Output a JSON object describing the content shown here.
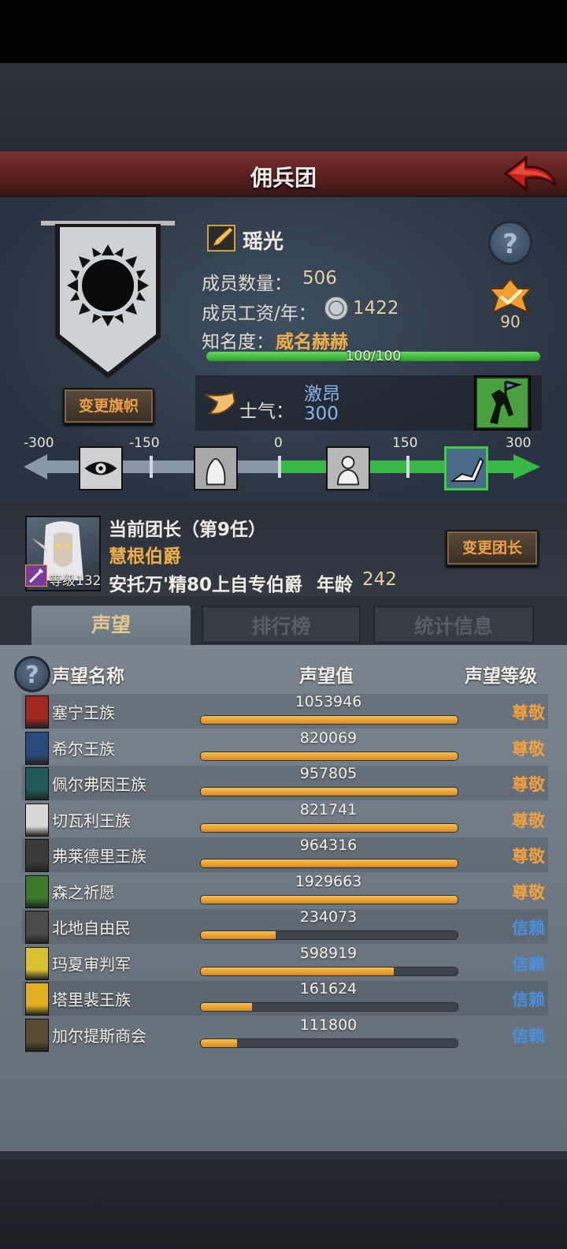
{
  "header": {
    "title": "佣兵团"
  },
  "company": {
    "name": "瑶光",
    "members_label": "成员数量：",
    "members_value": "506",
    "salary_label": "成员工资/年：",
    "salary_value": "1422",
    "fame_label": "知名度：",
    "fame_value": "威名赫赫",
    "fame_progress": "100/100",
    "fame_fraction": 1.0,
    "badge_value": "90",
    "change_banner_label": "变更旗帜"
  },
  "morale": {
    "label": "士气：",
    "state": "激昂",
    "value": "300",
    "scale_ticks": [
      "-300",
      "-150",
      "0",
      "150",
      "300"
    ]
  },
  "leader": {
    "title": "当前团长（第9任）",
    "name": "慧根伯爵",
    "level": "等级132",
    "info": "安托万'精80上自专伯爵",
    "age_label": "年龄",
    "age_value": "242",
    "change_leader_label": "变更团长"
  },
  "tabs": [
    {
      "label": "声望",
      "active": true
    },
    {
      "label": "排行榜",
      "active": false
    },
    {
      "label": "统计信息",
      "active": false
    }
  ],
  "table": {
    "headers": {
      "name": "声望名称",
      "value": "声望值",
      "level": "声望等级"
    },
    "rows": [
      {
        "name": "塞宁王族",
        "value": "1053946",
        "fill": 1.0,
        "level": "尊敬",
        "level_color": "#f0a040",
        "icon_color": "#a02820"
      },
      {
        "name": "希尔王族",
        "value": "820069",
        "fill": 1.0,
        "level": "尊敬",
        "level_color": "#f0a040",
        "icon_color": "#2a4a7a"
      },
      {
        "name": "佩尔弗因王族",
        "value": "957805",
        "fill": 1.0,
        "level": "尊敬",
        "level_color": "#f0a040",
        "icon_color": "#1e5a5a"
      },
      {
        "name": "切瓦利王族",
        "value": "821741",
        "fill": 1.0,
        "level": "尊敬",
        "level_color": "#f0a040",
        "icon_color": "#d8d8d8"
      },
      {
        "name": "弗莱德里王族",
        "value": "964316",
        "fill": 1.0,
        "level": "尊敬",
        "level_color": "#f0a040",
        "icon_color": "#3a3a3a"
      },
      {
        "name": "森之祈愿",
        "value": "1929663",
        "fill": 1.0,
        "level": "尊敬",
        "level_color": "#f0a040",
        "icon_color": "#3a7a2a"
      },
      {
        "name": "北地自由民",
        "value": "234073",
        "fill": 0.29,
        "level": "信赖",
        "level_color": "#4a90e0",
        "icon_color": "#4a4a4a"
      },
      {
        "name": "玛夏审判军",
        "value": "598919",
        "fill": 0.75,
        "level": "信赖",
        "level_color": "#4a90e0",
        "icon_color": "#d8c030"
      },
      {
        "name": "塔里裴王族",
        "value": "161624",
        "fill": 0.2,
        "level": "信赖",
        "level_color": "#4a90e0",
        "icon_color": "#e0b020"
      },
      {
        "name": "加尔提斯商会",
        "value": "111800",
        "fill": 0.14,
        "level": "信赖",
        "level_color": "#4a90e0",
        "icon_color": "#5a4a30"
      }
    ]
  }
}
